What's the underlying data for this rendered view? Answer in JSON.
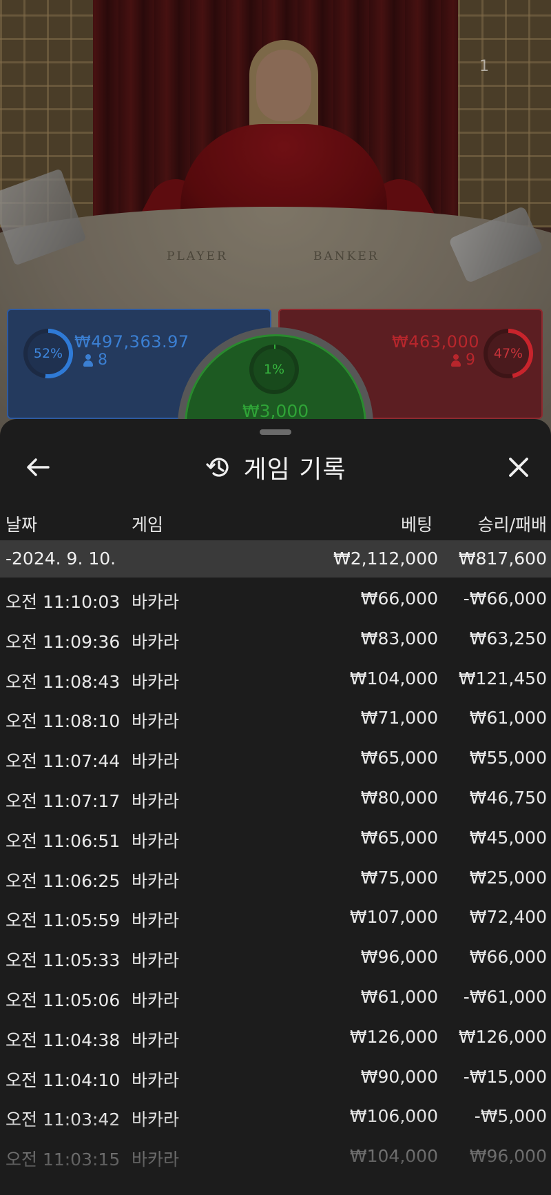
{
  "video": {
    "felt_player_label": "PLAYER",
    "felt_banker_label": "BANKER",
    "overlay_number": "1"
  },
  "bets": {
    "player": {
      "percent": "52%",
      "amount": "₩497,363.97",
      "players": "8",
      "color": "#2f7ad6"
    },
    "banker": {
      "percent": "47%",
      "amount": "₩463,000",
      "players": "9",
      "color": "#c8242c"
    },
    "tie": {
      "percent": "1%",
      "amount": "₩3,000",
      "color": "#2fae37"
    }
  },
  "sheet": {
    "title": "게임 기록",
    "back_icon": "arrow-left-icon",
    "history_icon": "history-icon",
    "close_icon": "close-icon"
  },
  "table": {
    "columns": {
      "date": "날짜",
      "game": "게임",
      "bet": "베팅",
      "win_loss": "승리/패배"
    },
    "date_group": {
      "date": "-2024. 9. 10.",
      "bet_total": "₩2,112,000",
      "win_total": "₩817,600"
    },
    "rows": [
      {
        "time": "오전 11:10:03",
        "game": "바카라",
        "bet": "₩66,000",
        "result": "-₩66,000"
      },
      {
        "time": "오전 11:09:36",
        "game": "바카라",
        "bet": "₩83,000",
        "result": "₩63,250"
      },
      {
        "time": "오전 11:08:43",
        "game": "바카라",
        "bet": "₩104,000",
        "result": "₩121,450"
      },
      {
        "time": "오전 11:08:10",
        "game": "바카라",
        "bet": "₩71,000",
        "result": "₩61,000"
      },
      {
        "time": "오전 11:07:44",
        "game": "바카라",
        "bet": "₩65,000",
        "result": "₩55,000"
      },
      {
        "time": "오전 11:07:17",
        "game": "바카라",
        "bet": "₩80,000",
        "result": "₩46,750"
      },
      {
        "time": "오전 11:06:51",
        "game": "바카라",
        "bet": "₩65,000",
        "result": "₩45,000"
      },
      {
        "time": "오전 11:06:25",
        "game": "바카라",
        "bet": "₩75,000",
        "result": "₩25,000"
      },
      {
        "time": "오전 11:05:59",
        "game": "바카라",
        "bet": "₩107,000",
        "result": "₩72,400"
      },
      {
        "time": "오전 11:05:33",
        "game": "바카라",
        "bet": "₩96,000",
        "result": "₩66,000"
      },
      {
        "time": "오전 11:05:06",
        "game": "바카라",
        "bet": "₩61,000",
        "result": "-₩61,000"
      },
      {
        "time": "오전 11:04:38",
        "game": "바카라",
        "bet": "₩126,000",
        "result": "₩126,000"
      },
      {
        "time": "오전 11:04:10",
        "game": "바카라",
        "bet": "₩90,000",
        "result": "-₩15,000"
      },
      {
        "time": "오전 11:03:42",
        "game": "바카라",
        "bet": "₩106,000",
        "result": "-₩5,000"
      },
      {
        "time": "오전 11:03:15",
        "game": "바카라",
        "bet": "₩104,000",
        "result": "₩96,000"
      }
    ]
  }
}
